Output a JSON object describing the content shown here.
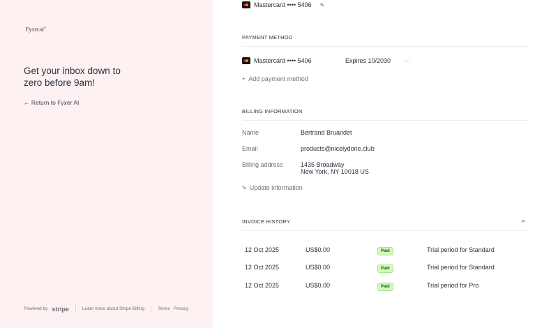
{
  "left": {
    "logo": "Fyxer.ai",
    "logo_sup": "(R)",
    "headline": "Get your inbox down to zero before 9am!",
    "back": "Return to Fyxer AI",
    "footer": {
      "powered": "Powered by",
      "stripe": "stripe",
      "learn": "Learn more about Stripe Billing",
      "terms": "Terms",
      "privacy": "Privacy"
    }
  },
  "top_card": "Mastercard •••• 5406",
  "payment": {
    "title": "PAYMENT METHOD",
    "card": "Mastercard •••• 5406",
    "expires": "Expires 10/2030",
    "more": "···",
    "add": "Add payment method"
  },
  "billing": {
    "title": "BILLING INFORMATION",
    "fields": [
      {
        "label": "Name",
        "value": "Bertrand Bruandet"
      },
      {
        "label": "Email",
        "value": "products@nicelydone.club"
      },
      {
        "label": "Billing address",
        "value": "1435 Broadway",
        "value2": "New York, NY 10018 US"
      }
    ],
    "update": "Update information"
  },
  "invoices": {
    "title": "INVOICE HISTORY",
    "rows": [
      {
        "date": "12 Oct 2025",
        "amount": "US$0.00",
        "status": "Paid",
        "desc": "Trial period for Standard"
      },
      {
        "date": "12 Oct 2025",
        "amount": "US$0.00",
        "status": "Paid",
        "desc": "Trial period for Standard"
      },
      {
        "date": "12 Oct 2025",
        "amount": "US$0.00",
        "status": "Paid",
        "desc": "Trial period for Pro"
      }
    ]
  }
}
